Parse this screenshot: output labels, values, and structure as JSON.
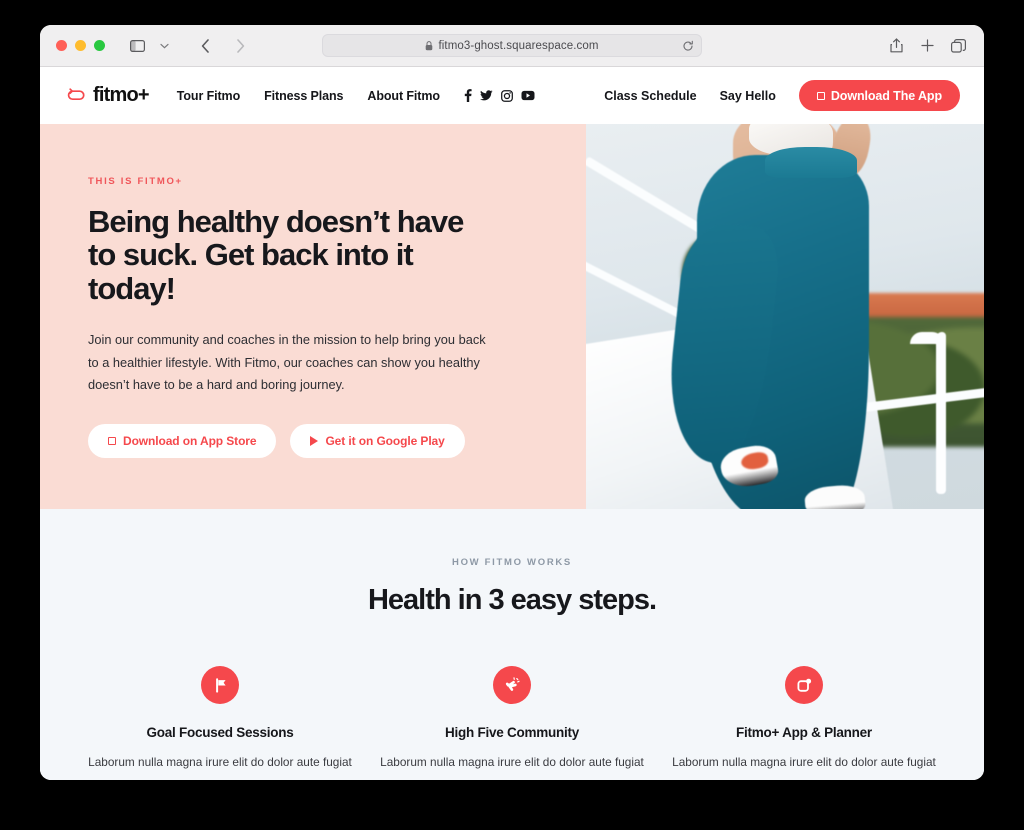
{
  "browser": {
    "url": "fitmo3-ghost.squarespace.com",
    "lock_icon": "lock-icon",
    "reload_icon": "reload-icon",
    "sidebar_icon": "sidebar-toggle-icon",
    "chevron_icon": "chevron-down-icon",
    "back_icon": "back-arrow-icon",
    "forward_icon": "forward-arrow-icon",
    "share_icon": "share-icon",
    "newtab_icon": "plus-icon",
    "tabs_icon": "tab-overview-icon",
    "traffic_lights": [
      "close",
      "minimize",
      "zoom"
    ]
  },
  "site_header": {
    "logo_text": "fitmo+",
    "logo_icon": "loop-arrow-icon",
    "nav": [
      {
        "label": "Tour Fitmo"
      },
      {
        "label": "Fitness Plans"
      },
      {
        "label": "About Fitmo"
      }
    ],
    "social": [
      {
        "name": "facebook-icon"
      },
      {
        "name": "twitter-icon"
      },
      {
        "name": "instagram-icon"
      },
      {
        "name": "youtube-icon"
      }
    ],
    "right_links": [
      {
        "label": "Class Schedule"
      },
      {
        "label": "Say Hello"
      }
    ],
    "cta": {
      "label": "Download The App",
      "icon": "app-square-icon"
    }
  },
  "hero": {
    "eyebrow": "THIS IS FITMO+",
    "title": "Being healthy doesn’t have to suck. Get back into it today!",
    "paragraph": "Join our community and coaches in the mission to help bring you back to a healthier lifestyle. With Fitmo, our coaches can show you healthy doesn’t have to be a hard and boring journey.",
    "buttons": [
      {
        "label": "Download on App Store",
        "icon": "app-store-icon"
      },
      {
        "label": "Get it on Google Play",
        "icon": "google-play-icon"
      }
    ],
    "image_alt": "Woman in teal leggings climbing white outdoor stairs"
  },
  "steps": {
    "kicker": "HOW FITMO WORKS",
    "title": "Health in 3 easy steps.",
    "cards": [
      {
        "icon": "flag-icon",
        "title": "Goal Focused Sessions",
        "body": "Laborum nulla magna irure elit do dolor aute fugiat"
      },
      {
        "icon": "clapping-hands-icon",
        "title": "High Five Community",
        "body": "Laborum nulla magna irure elit do dolor aute fugiat"
      },
      {
        "icon": "app-planner-icon",
        "title": "Fitmo+ App & Planner",
        "body": "Laborum nulla magna irure elit do dolor aute fugiat"
      }
    ]
  },
  "colors": {
    "accent_red": "#F5484C",
    "hero_bg": "#FADCD4",
    "section_bg": "#F4F7FA",
    "text_dark": "#17181C",
    "kicker_gray": "#8E99A6"
  }
}
